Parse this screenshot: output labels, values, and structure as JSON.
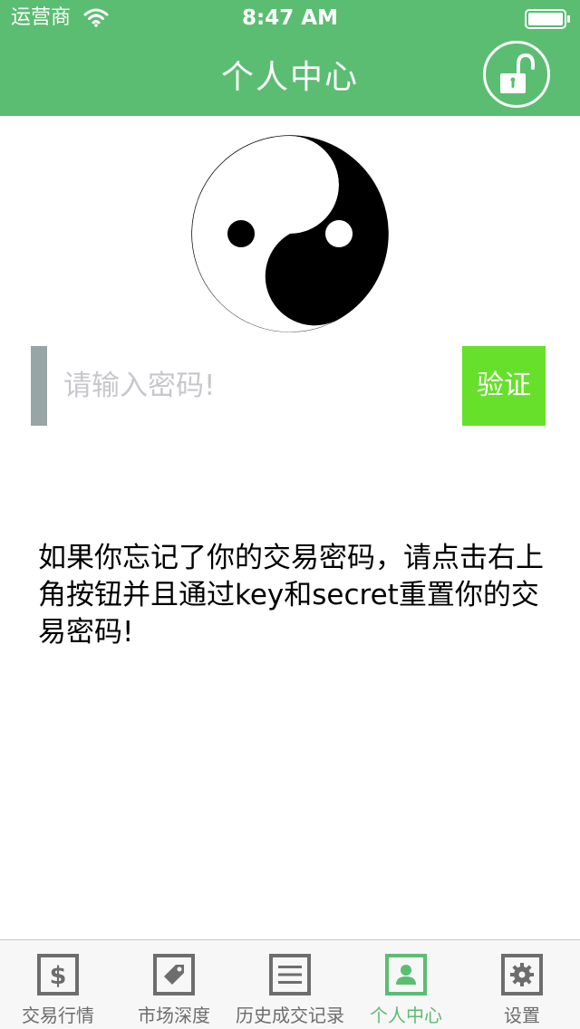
{
  "status_bar": {
    "carrier": "运营商",
    "time": "8:47 AM",
    "wifi_icon": "wifi-icon",
    "battery_icon": "battery-icon"
  },
  "nav": {
    "title": "个人中心",
    "right_icon": "unlock-icon"
  },
  "colors": {
    "header": "#5bbd72",
    "verify_button": "#66e02b",
    "input_accent": "#98a5a6",
    "tab_active": "#5bbd72",
    "tab_inactive": "#6d6d6d"
  },
  "avatar": {
    "icon": "yin-yang-icon"
  },
  "password": {
    "placeholder": "请输入密码!",
    "value": "",
    "verify_label": "验证"
  },
  "hint": {
    "text": "如果你忘记了你的交易密码，请点击右上角按钮并且通过key和secret重置你的交易密码!"
  },
  "tab_bar": {
    "active_index": 3,
    "tabs": [
      {
        "label": "交易行情",
        "icon": "dollar-icon"
      },
      {
        "label": "市场深度",
        "icon": "tag-icon"
      },
      {
        "label": "历史成交记录",
        "icon": "list-icon"
      },
      {
        "label": "个人中心",
        "icon": "user-icon"
      },
      {
        "label": "设置",
        "icon": "gear-icon"
      }
    ]
  }
}
